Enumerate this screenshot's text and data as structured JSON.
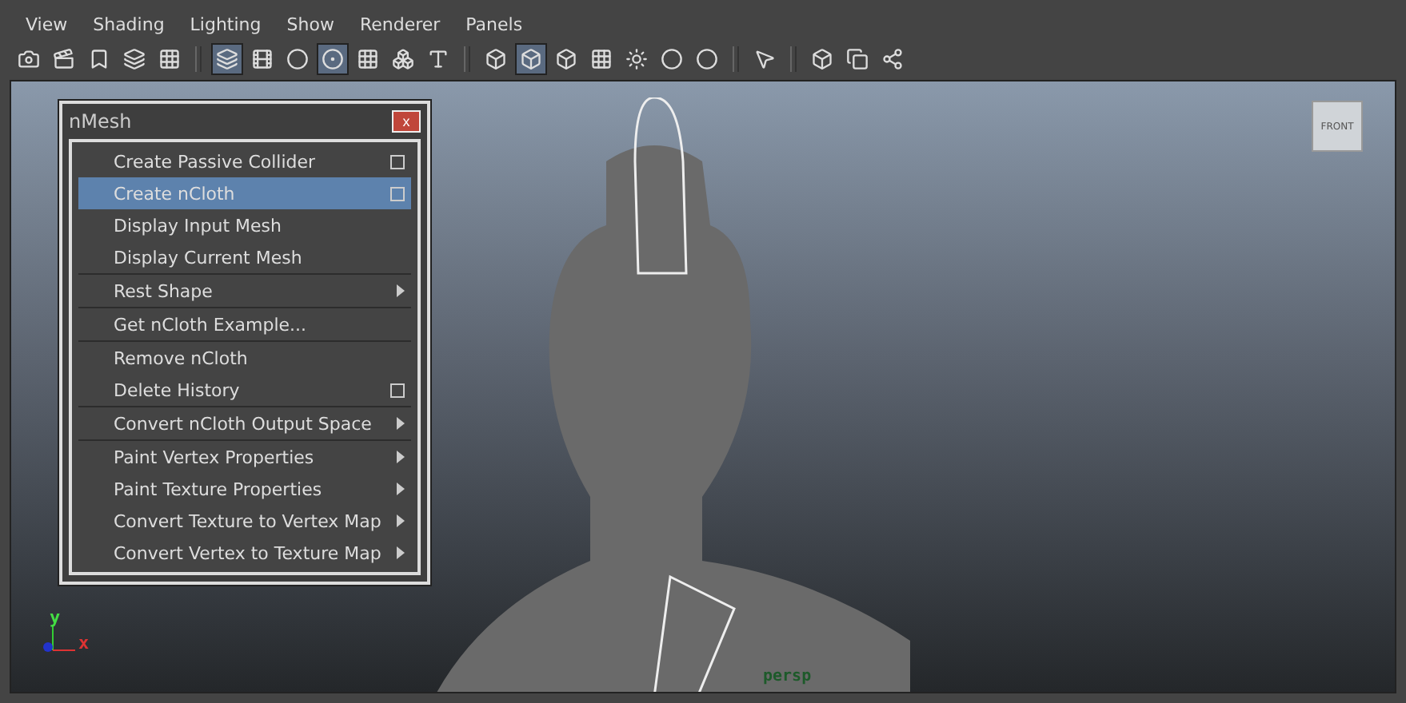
{
  "menu_bar": [
    "View",
    "Shading",
    "Lighting",
    "Show",
    "Renderer",
    "Panels"
  ],
  "toolbar_groups": [
    {
      "buttons": [
        {
          "kind": "camera",
          "pressed": false
        },
        {
          "kind": "clapper",
          "pressed": false
        },
        {
          "kind": "bookmark",
          "pressed": false
        },
        {
          "kind": "layers",
          "pressed": false
        },
        {
          "kind": "grid",
          "pressed": false
        }
      ]
    },
    {
      "buttons": [
        {
          "kind": "layers",
          "pressed": true
        },
        {
          "kind": "film",
          "pressed": false
        },
        {
          "kind": "circle",
          "pressed": false
        },
        {
          "kind": "target",
          "pressed": true
        },
        {
          "kind": "grid",
          "pressed": false
        },
        {
          "kind": "boxes",
          "pressed": false
        },
        {
          "kind": "type",
          "pressed": false
        }
      ]
    },
    {
      "buttons": [
        {
          "kind": "cube",
          "pressed": false
        },
        {
          "kind": "cube",
          "pressed": true
        },
        {
          "kind": "cube",
          "pressed": false
        },
        {
          "kind": "grid",
          "pressed": false
        },
        {
          "kind": "sun",
          "pressed": false
        },
        {
          "kind": "circle",
          "pressed": false
        },
        {
          "kind": "circle",
          "pressed": false
        }
      ]
    },
    {
      "buttons": [
        {
          "kind": "pointer",
          "pressed": false
        }
      ]
    },
    {
      "buttons": [
        {
          "kind": "cube",
          "pressed": false
        },
        {
          "kind": "copy",
          "pressed": false
        },
        {
          "kind": "share",
          "pressed": false
        }
      ]
    }
  ],
  "panel": {
    "title": "nMesh",
    "close": "x",
    "items": [
      {
        "label": "Create Passive Collider",
        "kind": "option",
        "selected": false,
        "divider_after": false
      },
      {
        "label": "Create nCloth",
        "kind": "option",
        "selected": true,
        "divider_after": false
      },
      {
        "label": "Display Input Mesh",
        "kind": "plain",
        "selected": false,
        "divider_after": false
      },
      {
        "label": "Display Current Mesh",
        "kind": "plain",
        "selected": false,
        "divider_after": true
      },
      {
        "label": "Rest Shape",
        "kind": "submenu",
        "selected": false,
        "divider_after": true
      },
      {
        "label": "Get nCloth Example...",
        "kind": "plain",
        "selected": false,
        "divider_after": true
      },
      {
        "label": "Remove nCloth",
        "kind": "plain",
        "selected": false,
        "divider_after": false
      },
      {
        "label": "Delete History",
        "kind": "option",
        "selected": false,
        "divider_after": true
      },
      {
        "label": "Convert nCloth Output Space",
        "kind": "submenu",
        "selected": false,
        "divider_after": true
      },
      {
        "label": "Paint Vertex Properties",
        "kind": "submenu",
        "selected": false,
        "divider_after": false
      },
      {
        "label": "Paint Texture Properties",
        "kind": "submenu",
        "selected": false,
        "divider_after": false
      },
      {
        "label": "Convert Texture to Vertex Map",
        "kind": "submenu",
        "selected": false,
        "divider_after": false
      },
      {
        "label": "Convert Vertex to Texture Map",
        "kind": "submenu",
        "selected": false,
        "divider_after": false
      }
    ]
  },
  "view_cube": {
    "label": "FRONT"
  },
  "axis": {
    "y": "y",
    "x": "x"
  },
  "camera_label": "persp"
}
